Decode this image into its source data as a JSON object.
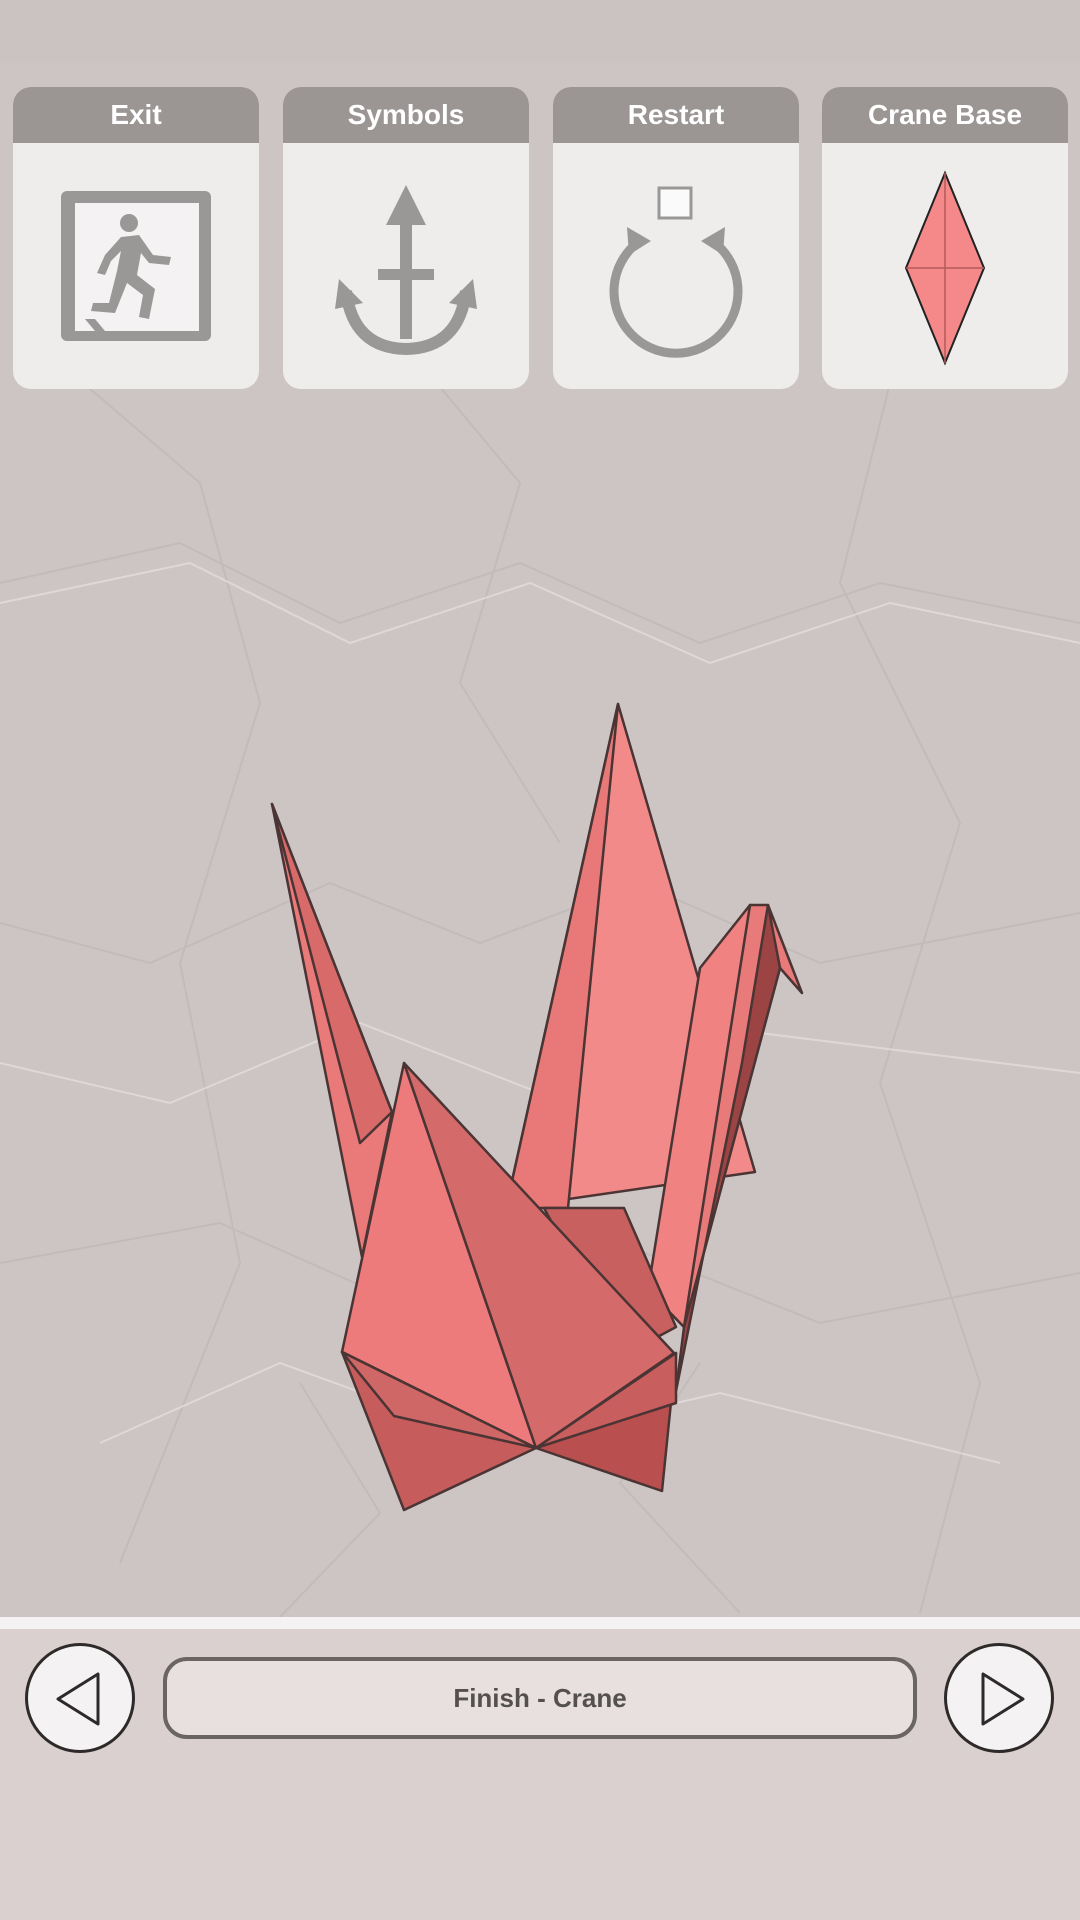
{
  "menu": {
    "exit_label": "Exit",
    "symbols_label": "Symbols",
    "restart_label": "Restart",
    "base_label": "Crane Base"
  },
  "navigation": {
    "step_label": "Finish - Crane"
  },
  "colors": {
    "paper_bg": "#cdc5c4",
    "card_header": "#9b9594",
    "crane_pink": "#f08080",
    "icon_gray": "#9a9797"
  },
  "icons": [
    "exit-icon",
    "anchor-icon",
    "restart-icon",
    "crane-base-diamond-icon",
    "previous-arrow-icon",
    "next-arrow-icon"
  ]
}
